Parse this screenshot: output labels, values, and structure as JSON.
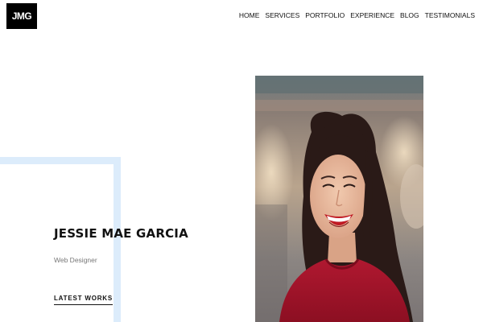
{
  "header": {
    "logo_text": "JMG",
    "nav": [
      {
        "label": "HOME"
      },
      {
        "label": "SERVICES"
      },
      {
        "label": "PORTFOLIO"
      },
      {
        "label": "EXPERIENCE"
      },
      {
        "label": "BLOG"
      },
      {
        "label": "TESTIMONIALS"
      }
    ]
  },
  "hero": {
    "name": "JESSIE MAE GARCIA",
    "role": "Web Designer",
    "cta_label": "LATEST WORKS"
  },
  "colors": {
    "accent_frame": "#dcecfb",
    "logo_bg": "#000000",
    "text_dark": "#111111",
    "text_muted": "#777777"
  },
  "photo": {
    "subject": "smiling woman in red sweater"
  }
}
